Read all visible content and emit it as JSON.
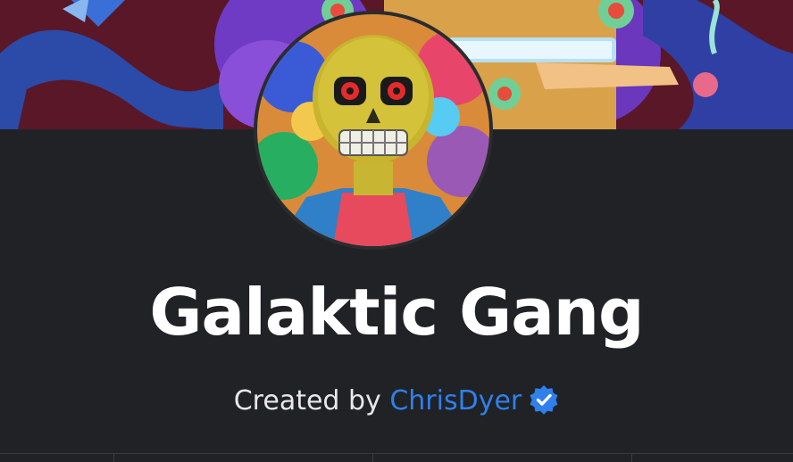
{
  "collection": {
    "title": "Galaktic Gang",
    "created_by_prefix": "Created by ",
    "creator_name": "ChrisDyer",
    "creator_verified": true
  },
  "images": {
    "banner": "psychedelic-monster-artwork",
    "avatar": "skull-character-artwork"
  },
  "colors": {
    "background": "#202225",
    "title": "#ffffff",
    "creator_link": "#2f80ed",
    "verified_badge": "#2f80ed"
  }
}
